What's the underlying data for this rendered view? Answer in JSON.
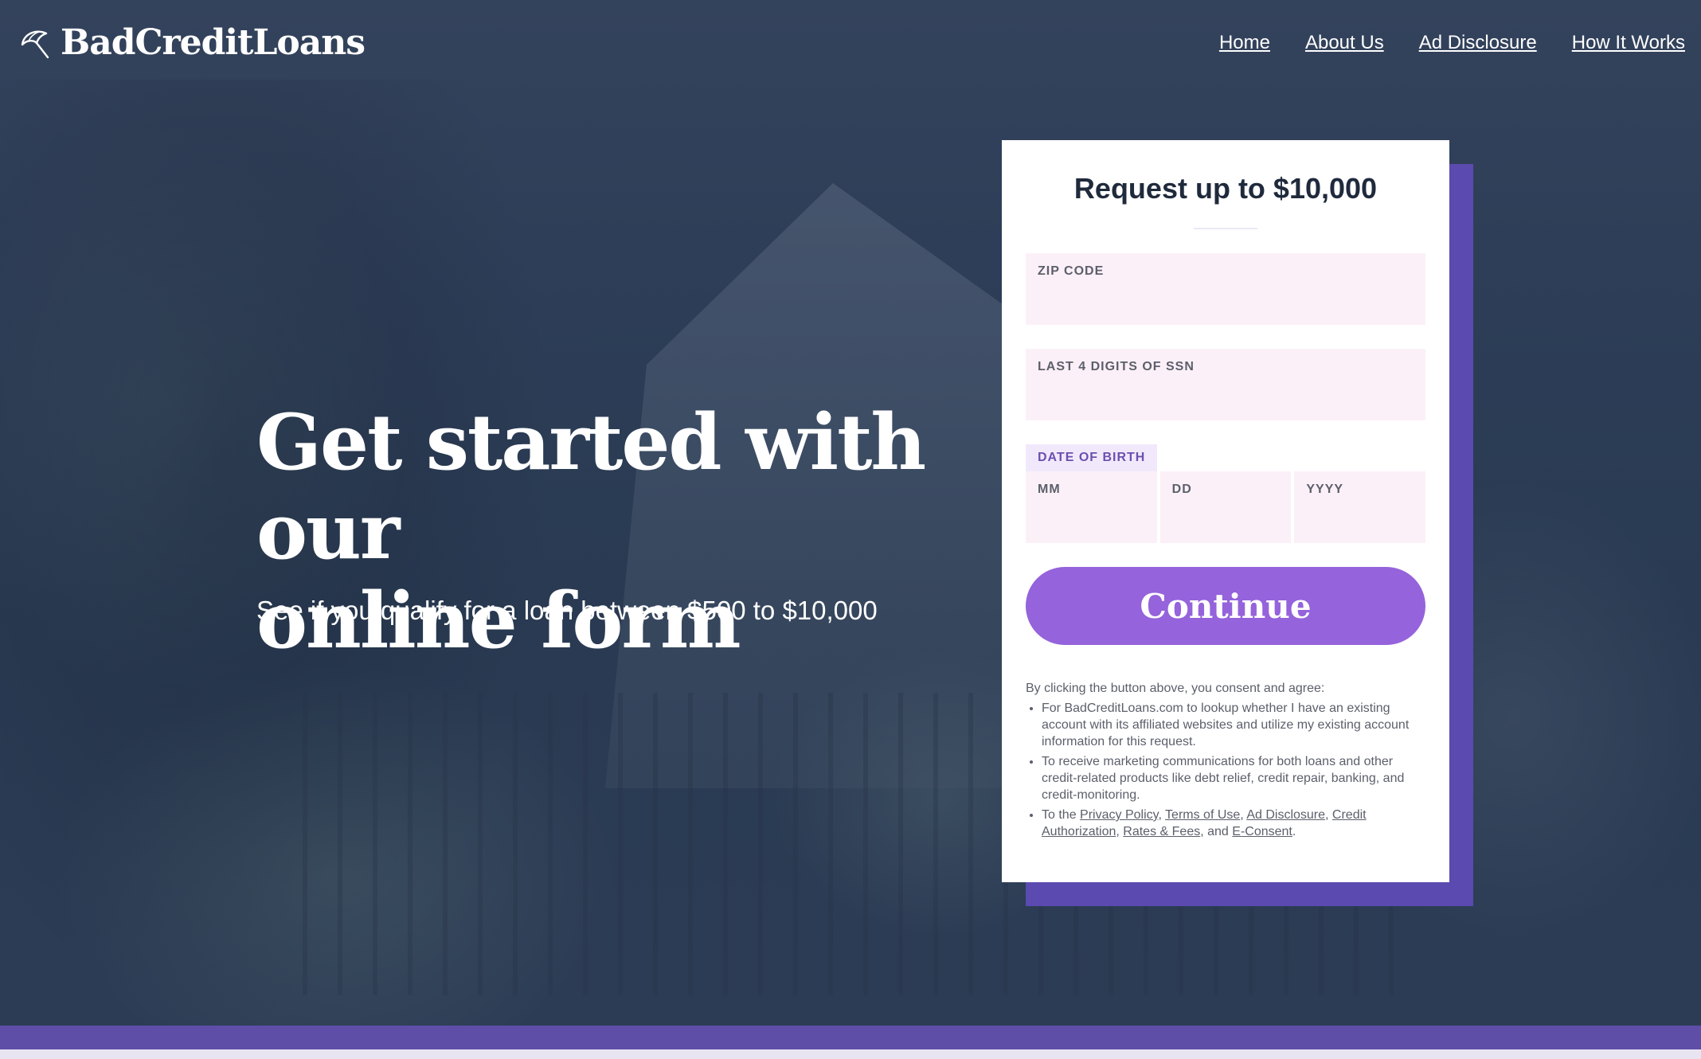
{
  "header": {
    "brand": "BadCreditLoans",
    "nav": [
      "Home",
      "About Us",
      "Ad Disclosure",
      "How It Works"
    ]
  },
  "hero": {
    "headline_line1": "Get started with our",
    "headline_line2": "online form",
    "subhead": "See if you qualify for a loan between $500 to $10,000"
  },
  "form": {
    "title": "Request up to $10,000",
    "zip_label": "ZIP CODE",
    "ssn_label": "LAST 4 DIGITS OF SSN",
    "dob_label": "DATE OF BIRTH",
    "dob_mm": "MM",
    "dob_dd": "DD",
    "dob_yyyy": "YYYY",
    "continue_label": "Continue"
  },
  "consent": {
    "intro": "By clicking the button above, you consent and agree:",
    "item1": "For BadCreditLoans.com to lookup whether I have an existing account with its affiliated websites and utilize my existing account information for this request.",
    "item2": "To receive marketing communications for both loans and other credit-related products like debt relief, credit repair, banking, and credit-monitoring.",
    "item3_prefix": "To the",
    "links": [
      "Privacy Policy",
      "Terms of Use",
      "Ad Disclosure",
      "Credit Authorization",
      "Rates & Fees",
      "E-Consent"
    ],
    "and": "and"
  },
  "colors": {
    "accent": "#9563db",
    "card_shadow": "#5b4ab0",
    "field_bg": "#fcf0f8",
    "hero_bg": "#2b3b55"
  },
  "icons": {
    "logo": "umbrella-icon"
  }
}
